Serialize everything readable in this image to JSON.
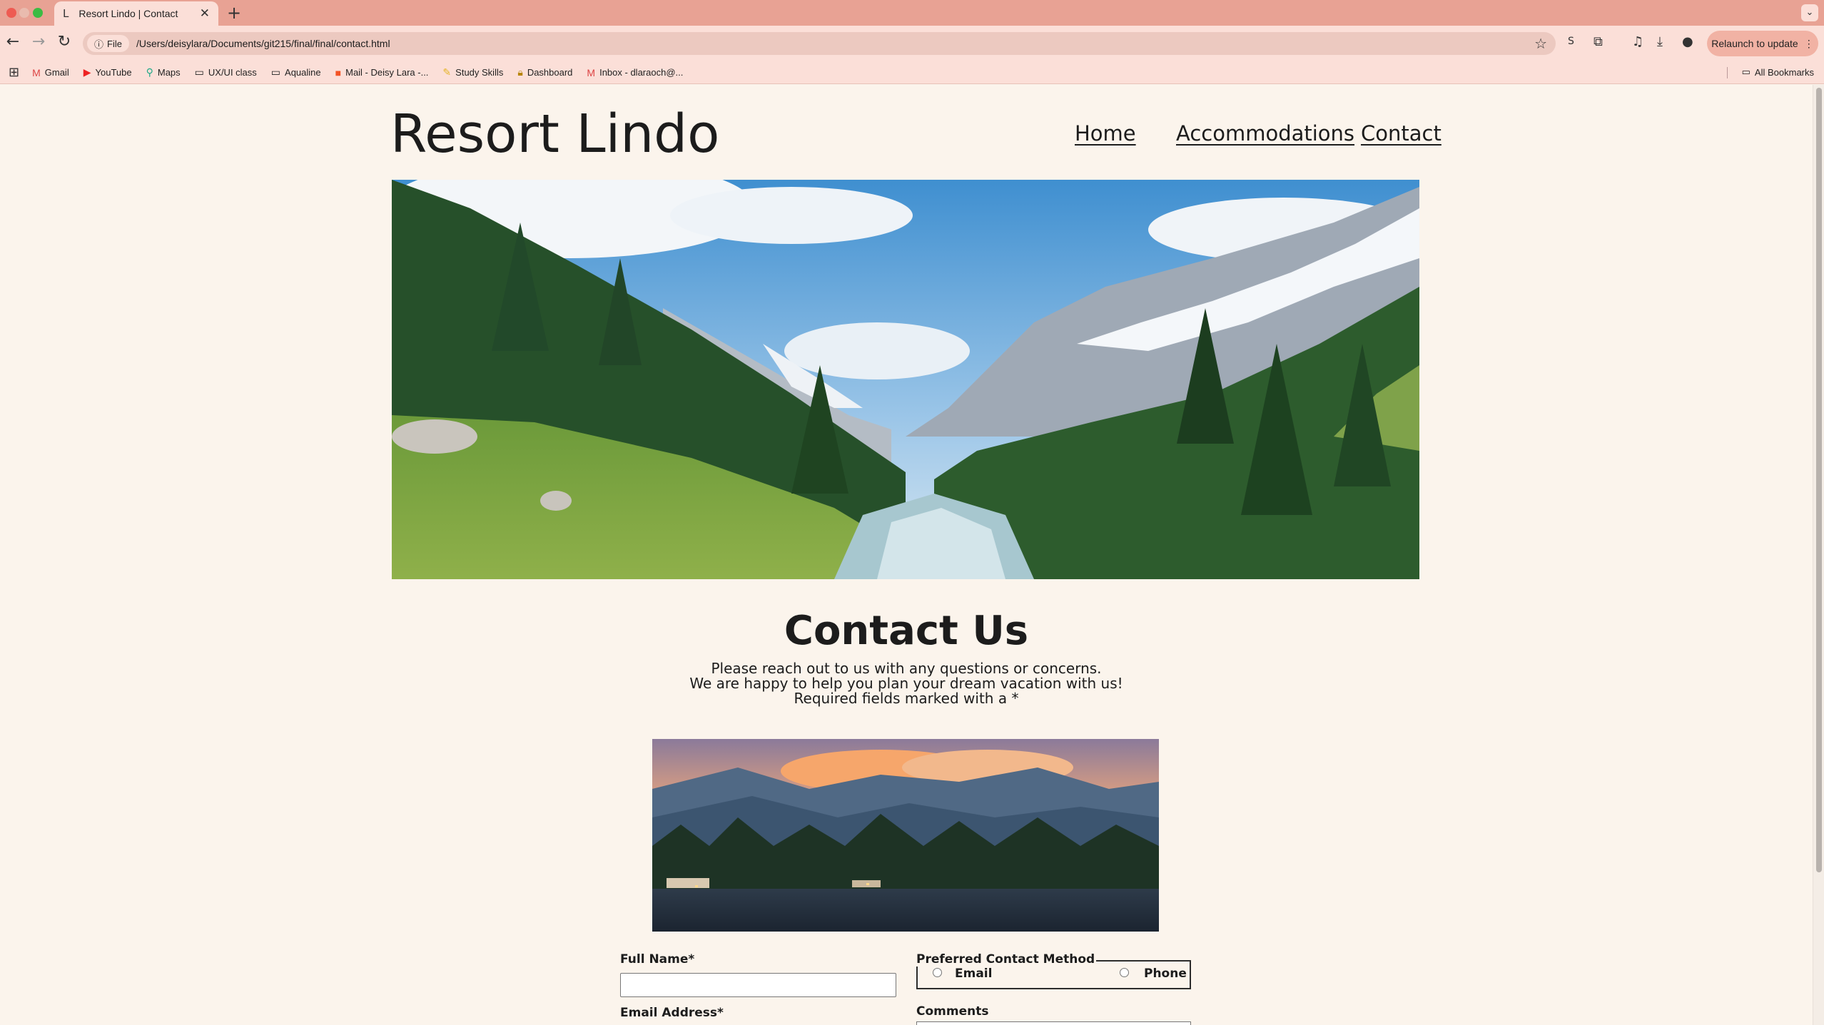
{
  "browser": {
    "tab_title": "Resort Lindo | Contact",
    "tab_favicon": "L",
    "address_scheme": "File",
    "url": "/Users/deisylara/Documents/git215/final/final/contact.html",
    "relaunch_label": "Relaunch to update",
    "profile_initial": "S",
    "bookmarks": [
      {
        "label": "Gmail",
        "icon": "gmail-icon"
      },
      {
        "label": "YouTube",
        "icon": "youtube-icon"
      },
      {
        "label": "Maps",
        "icon": "maps-icon"
      },
      {
        "label": "UX/UI class",
        "icon": "folder-icon"
      },
      {
        "label": "Aqualine",
        "icon": "folder-icon"
      },
      {
        "label": "Mail - Deisy Lara -...",
        "icon": "outlook-icon"
      },
      {
        "label": "Study Skills",
        "icon": "notes-icon"
      },
      {
        "label": "Dashboard",
        "icon": "lock-icon"
      },
      {
        "label": "Inbox - dlaraoch@...",
        "icon": "gmail-icon"
      }
    ],
    "all_bookmarks_label": "All Bookmarks"
  },
  "site": {
    "title": "Resort Lindo",
    "nav": [
      "Home",
      "Accommodations",
      "Contact"
    ]
  },
  "contact": {
    "heading": "Contact Us",
    "intro_line1": "Please reach out to us with any questions or concerns.",
    "intro_line2": "We are happy to help you plan your dream vacation with us!",
    "intro_line3": "Required fields marked with a *"
  },
  "form": {
    "full_name_label": "Full Name*",
    "full_name_value": "",
    "email_label": "Email Address*",
    "preferred_legend": "Preferred Contact Method",
    "option_email": "Email",
    "option_phone": "Phone",
    "comments_label": "Comments"
  }
}
